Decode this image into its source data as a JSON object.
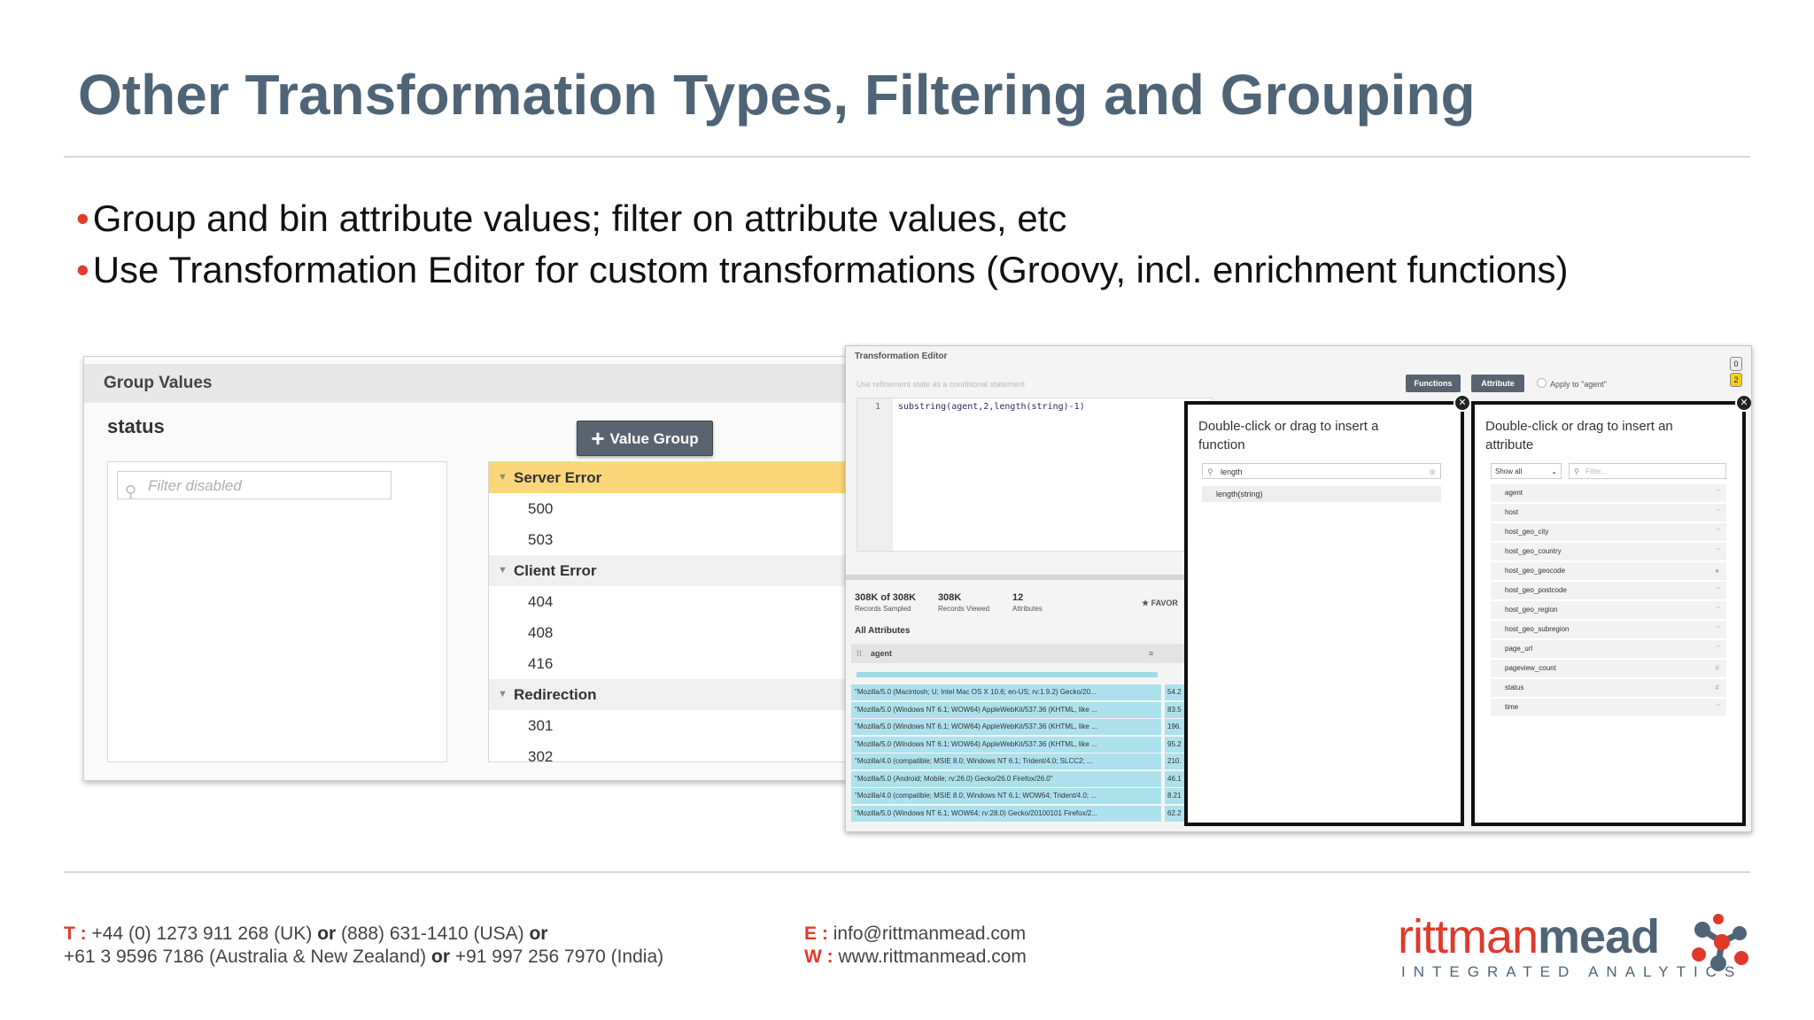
{
  "slide": {
    "title": "Other Transformation Types, Filtering and Grouping",
    "bullets": [
      "Group and bin attribute values; filter on attribute values, etc",
      "Use Transformation Editor for custom transformations (Groovy, incl. enrichment functions)"
    ],
    "accent_color": "#e53b2c",
    "title_color": "#4f6577"
  },
  "group_values": {
    "header": "Group Values",
    "field": "status",
    "filter_placeholder": "Filter disabled",
    "add_button": "Value Group",
    "groups": [
      {
        "name": "Server Error",
        "selected": true,
        "values": [
          "500",
          "503"
        ]
      },
      {
        "name": "Client Error",
        "selected": false,
        "values": [
          "404",
          "408",
          "416"
        ]
      },
      {
        "name": "Redirection",
        "selected": false,
        "values": [
          "301",
          "302"
        ]
      }
    ]
  },
  "transformation_editor": {
    "title": "Transformation Editor",
    "hint": "Use refinement state as a conditional statement",
    "functions_button": "Functions",
    "attribute_button": "Attribute",
    "apply_label": "Apply to \"agent\"",
    "badges": [
      "0",
      "2"
    ],
    "code_line_number": "1",
    "code": "substring(agent,2,length(string)-1)",
    "stats": [
      {
        "value": "308K of 308K",
        "label": "Records Sampled"
      },
      {
        "value": "308K",
        "label": "Records Viewed"
      },
      {
        "value": "12",
        "label": "Attributes"
      }
    ],
    "favorites_label": "FAVOR",
    "all_attributes_label": "All Attributes",
    "column_header": "agent",
    "rows": [
      {
        "agent": "\"Mozilla/5.0 (Macintosh; U; Intel Mac OS X 10.6; en-US; rv:1.9.2) Gecko/20...",
        "value": "54.2"
      },
      {
        "agent": "\"Mozilla/5.0 (Windows NT 6.1; WOW64) AppleWebKit/537.36 (KHTML, like ...",
        "value": "83.5"
      },
      {
        "agent": "\"Mozilla/5.0 (Windows NT 6.1; WOW64) AppleWebKit/537.36 (KHTML, like ...",
        "value": "196."
      },
      {
        "agent": "\"Mozilla/5.0 (Windows NT 6.1; WOW64) AppleWebKit/537.36 (KHTML, like ...",
        "value": "95.2"
      },
      {
        "agent": "\"Mozilla/4.0 (compatible; MSIE 8.0; Windows NT 6.1; Trident/4.0; SLCC2; ...",
        "value": "210."
      },
      {
        "agent": "\"Mozilla/5.0 (Android; Mobile; rv:26.0) Gecko/26.0 Firefox/26.0\"",
        "value": "46.1"
      },
      {
        "agent": "\"Mozilla/4.0 (compatible; MSIE 8.0; Windows NT 6.1; WOW64; Trident/4.0; ...",
        "value": "8.21"
      },
      {
        "agent": "\"Mozilla/5.0 (Windows NT 6.1; WOW64; rv:28.0) Gecko/20100101 Firefox/2...",
        "value": "62.2"
      }
    ],
    "function_popup": {
      "title": "Double-click or drag to insert a function",
      "search_value": "length",
      "results": [
        "length(string)"
      ]
    },
    "attribute_popup": {
      "title": "Double-click or drag to insert an attribute",
      "show_select": "Show all",
      "filter_placeholder": "Filter...",
      "attributes": [
        {
          "name": "agent",
          "type": "string"
        },
        {
          "name": "host",
          "type": "string"
        },
        {
          "name": "host_geo_city",
          "type": "string"
        },
        {
          "name": "host_geo_country",
          "type": "string"
        },
        {
          "name": "host_geo_geocode",
          "type": "geo"
        },
        {
          "name": "host_geo_postcode",
          "type": "string"
        },
        {
          "name": "host_geo_region",
          "type": "string"
        },
        {
          "name": "host_geo_subregion",
          "type": "string"
        },
        {
          "name": "page_url",
          "type": "string"
        },
        {
          "name": "pageview_count",
          "type": "number"
        },
        {
          "name": "status",
          "type": "number"
        },
        {
          "name": "time",
          "type": "string"
        }
      ]
    }
  },
  "footer": {
    "phone_label": "T :",
    "phone_line1": "+44 (0) 1273 911 268 (UK) ",
    "or": "or",
    "phone_line1b": " (888) 631-1410 (USA) ",
    "phone_line2a": "+61 3 9596 7186 (Australia & New Zealand) ",
    "phone_line2b": " +91 997 256 7970 (India)",
    "email_label": "E :",
    "email": "info@rittmanmead.com",
    "web_label": "W :",
    "web": "www.rittmanmead.com",
    "logo_part1": "rittman",
    "logo_part2": "mead",
    "logo_tagline": "INTEGRATED ANALYTICS"
  }
}
